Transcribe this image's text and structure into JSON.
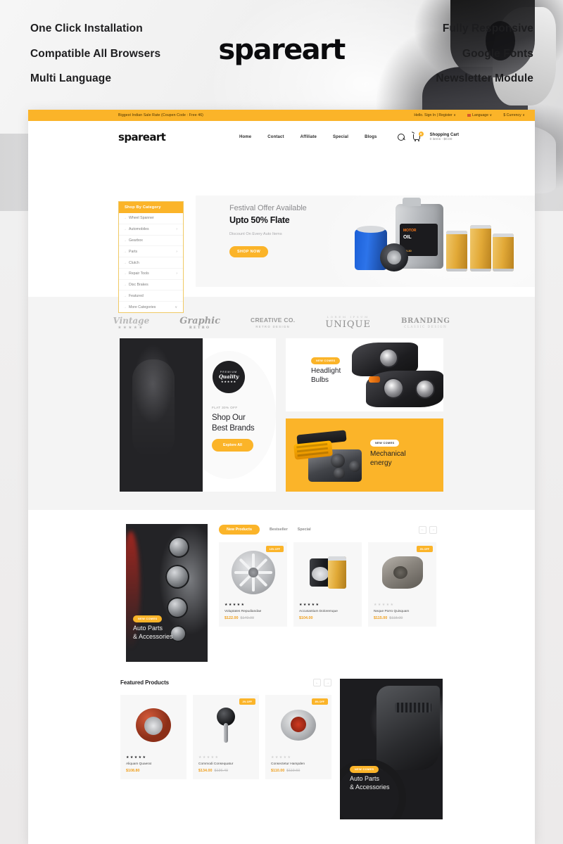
{
  "promo": {
    "left_features": [
      "One Click Installation",
      "Compatible All Browsers",
      "Multi Language"
    ],
    "right_features": [
      "Fully Responsive",
      "Google Fonts",
      "Newsletter Module"
    ],
    "wordmark": "spareart"
  },
  "site": {
    "announcement": "Biggest Indian Sale Rate (Coupen Code : Free 46)",
    "account": "Hello. Sign In | Register",
    "language": "Language",
    "currency": "$ Currency",
    "caret": "∨",
    "logo": "spareart",
    "nav": [
      "Home",
      "Contact",
      "Affiliate",
      "Special",
      "Blogs"
    ],
    "cart": {
      "title": "Shopping Cart",
      "summary": "0 items - $0.00",
      "count": "0"
    },
    "category": {
      "heading": "Shop By Category",
      "items": [
        {
          "label": "Wheel Spanner",
          "arrow": ""
        },
        {
          "label": "Automobiles",
          "arrow": "›"
        },
        {
          "label": "Gearbox",
          "arrow": ""
        },
        {
          "label": "Parts",
          "arrow": "›"
        },
        {
          "label": "Clutch",
          "arrow": ""
        },
        {
          "label": "Repair Tools",
          "arrow": "›"
        },
        {
          "label": "Disc Brakes",
          "arrow": ""
        },
        {
          "label": "Featured",
          "arrow": ""
        },
        {
          "label": "More Categories",
          "arrow": "∨"
        }
      ]
    },
    "hero": {
      "eyebrow": "Festival Offer Available",
      "title": "Upto 50% Flate",
      "subtitle": "Discount On Every Auto Items",
      "cta": "SHOP NOW",
      "product_brand": "MOTOR",
      "product_name": "OIL",
      "product_grade": "5W-30"
    },
    "brands": [
      {
        "name": "Vintage",
        "sub": "★★★★★"
      },
      {
        "name": "Graphic",
        "sub": "RETRO"
      },
      {
        "name": "CREATIVE CO.",
        "sub": "RETRO DESIGN"
      },
      {
        "name": "UNIQUE",
        "sub": "LOREM IPSUM"
      },
      {
        "name": "BRANDING",
        "sub": "CLASSIC DESIGN"
      }
    ],
    "promo_banners": {
      "brands_card": {
        "eyebrow": "FLAT 30% OFF",
        "title_line1": "Shop Our",
        "title_line2": "Best Brands",
        "cta": "Explore All",
        "seal_top": "PREMIUM",
        "seal_mid": "Quality",
        "seal_bottom": "★★★★★"
      },
      "headlight": {
        "badge": "NEW COMES",
        "title_line1": "Headlight",
        "title_line2": "Bulbs"
      },
      "mechanical": {
        "badge": "NEW COMES",
        "title_line1": "Mechanical",
        "title_line2": "energy"
      }
    },
    "new_products": {
      "side_card": {
        "badge": "NEW COMES",
        "title_line1": "Auto Parts",
        "title_line2": "& Accessories"
      },
      "tabs": [
        "New Products",
        "Bestseller",
        "Special"
      ],
      "active_tab": "New Products",
      "prev": "←",
      "next": "→",
      "items": [
        {
          "badge": "13% OFF",
          "stars": "★★★★★",
          "rated": true,
          "title": "Voluptates Repudiandae",
          "price": "$122.00",
          "old_price": "$140.00"
        },
        {
          "badge": "",
          "stars": "★★★★★",
          "rated": true,
          "title": "Accusantium Doloremque",
          "price": "$104.00",
          "old_price": ""
        },
        {
          "badge": "3% OFF",
          "stars": "★★★★★",
          "rated": false,
          "title": "Neque Porro Quisquam",
          "price": "$115.00",
          "old_price": "$118.00"
        }
      ]
    },
    "featured": {
      "title": "Featured Products",
      "prev": "←",
      "next": "→",
      "side_card": {
        "badge": "NEW COMES",
        "title_line1": "Auto Parts",
        "title_line2": "& Accessories"
      },
      "items": [
        {
          "badge": "",
          "stars": "★★★★★",
          "rated": true,
          "title": "Aliquam Quaerat",
          "price": "$108.80",
          "old_price": ""
        },
        {
          "badge": "2% OFF",
          "stars": "★★★★★",
          "rated": false,
          "title": "Commodi Consequatur",
          "price": "$134.00",
          "old_price": "$136.40"
        },
        {
          "badge": "8% OFF",
          "stars": "★★★★★",
          "rated": false,
          "title": "Consectetur Hampden",
          "price": "$110.00",
          "old_price": "$119.60"
        }
      ]
    }
  },
  "colors": {
    "accent": "#fbb429",
    "dark": "#1d1d1f",
    "muted": "#8d8d8d"
  }
}
